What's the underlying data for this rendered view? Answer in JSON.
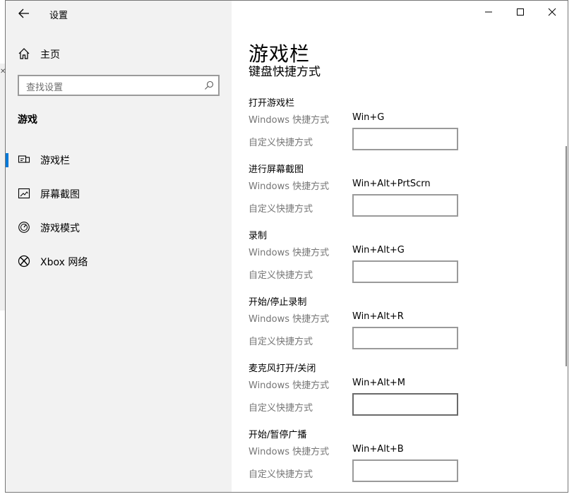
{
  "window": {
    "title": "设置"
  },
  "background": {
    "close_glyph": "✕"
  },
  "sidebar": {
    "home_label": "主页",
    "search_placeholder": "查找设置",
    "section_label": "游戏",
    "items": [
      {
        "label": "游戏栏",
        "icon": "game-bar-icon",
        "selected": true
      },
      {
        "label": "屏幕截图",
        "icon": "captures-icon",
        "selected": false
      },
      {
        "label": "游戏模式",
        "icon": "game-mode-icon",
        "selected": false
      },
      {
        "label": "Xbox 网络",
        "icon": "xbox-icon",
        "selected": false
      }
    ]
  },
  "main": {
    "page_title": "游戏栏",
    "section_heading": "键盘快捷方式",
    "windows_shortcut_label": "Windows 快捷方式",
    "custom_shortcut_label": "自定义快捷方式",
    "shortcuts": [
      {
        "name": "打开游戏栏",
        "windows": "Win+G",
        "custom": ""
      },
      {
        "name": "进行屏幕截图",
        "windows": "Win+Alt+PrtScrn",
        "custom": ""
      },
      {
        "name": "录制",
        "windows": "Win+Alt+G",
        "custom": ""
      },
      {
        "name": "开始/停止录制",
        "windows": "Win+Alt+R",
        "custom": ""
      },
      {
        "name": "麦克风打开/关闭",
        "windows": "Win+Alt+M",
        "custom": ""
      },
      {
        "name": "开始/暂停广播",
        "windows": "Win+Alt+B",
        "custom": ""
      }
    ]
  },
  "colors": {
    "accent": "#0078d7",
    "sidebar_bg": "#f2f2f2",
    "muted_text": "#767676"
  }
}
